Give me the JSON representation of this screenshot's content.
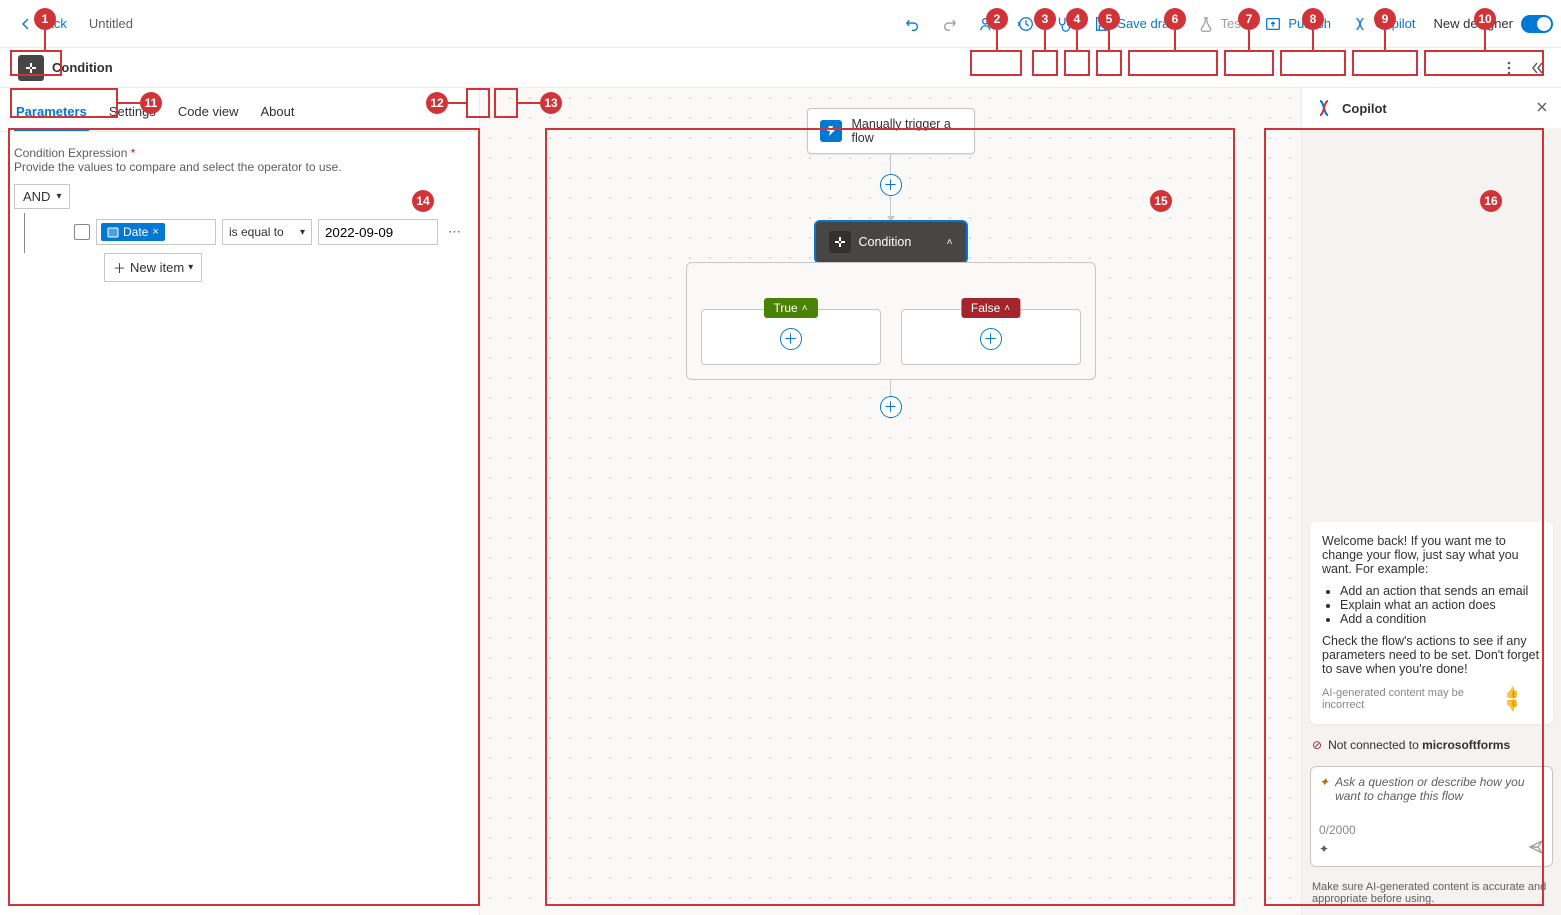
{
  "topbar": {
    "back": "Back",
    "title": "Untitled",
    "save_draft": "Save draft",
    "test": "Test",
    "publish": "Publish",
    "copilot": "Copilot",
    "new_designer": "New designer"
  },
  "panel": {
    "title": "Condition",
    "tabs": {
      "parameters": "Parameters",
      "settings": "Settings",
      "code_view": "Code view",
      "about": "About"
    },
    "field_label": "Condition Expression",
    "field_desc": "Provide the values to compare and select the operator to use.",
    "group_op": "AND",
    "row": {
      "token": "Date",
      "operator": "is equal to",
      "value": "2022-09-09"
    },
    "new_item": "New item"
  },
  "canvas": {
    "trigger": "Manually trigger a flow",
    "condition": "Condition",
    "true_label": "True",
    "false_label": "False"
  },
  "copilot": {
    "title": "Copilot",
    "welcome_1": "Welcome back! If you want me to change your flow, just say what you want. For example:",
    "suggest_1": "Add an action that sends an email",
    "suggest_2": "Explain what an action does",
    "suggest_3": "Add a condition",
    "welcome_2": "Check the flow's actions to see if any parameters need to be set. Don't forget to save when you're done!",
    "ai_note": "AI-generated content may be incorrect",
    "warn_prefix": "Not connected to ",
    "warn_bold": "microsoftforms",
    "placeholder": "Ask a question or describe how you want to change this flow",
    "counter": "0/2000",
    "footer": "Make sure AI-generated content is accurate and appropriate before using."
  },
  "annotations": {
    "n1": "1",
    "n2": "2",
    "n3": "3",
    "n4": "4",
    "n5": "5",
    "n6": "6",
    "n7": "7",
    "n8": "8",
    "n9": "9",
    "n10": "10",
    "n11": "11",
    "n12": "12",
    "n13": "13",
    "n14": "14",
    "n15": "15",
    "n16": "16"
  }
}
